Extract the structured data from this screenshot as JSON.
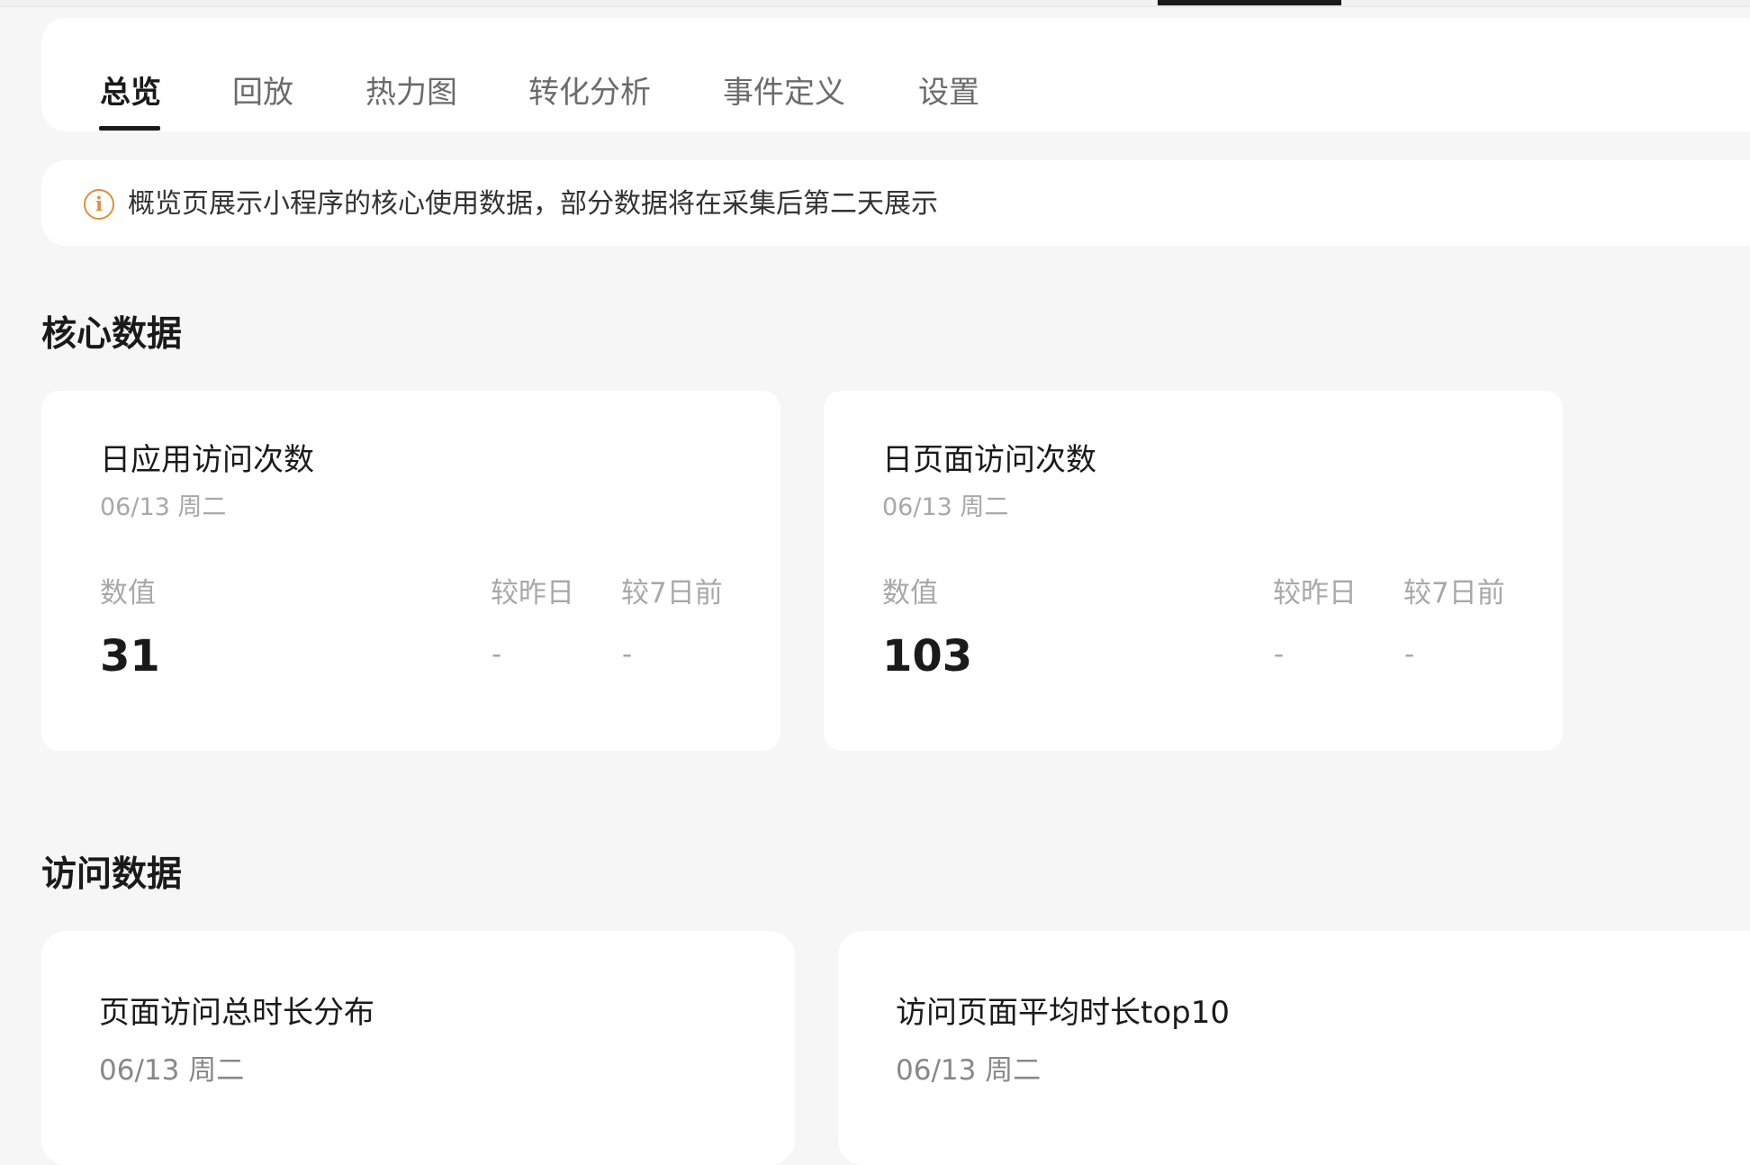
{
  "tabs": [
    {
      "label": "总览",
      "active": true
    },
    {
      "label": "回放",
      "active": false
    },
    {
      "label": "热力图",
      "active": false
    },
    {
      "label": "转化分析",
      "active": false
    },
    {
      "label": "事件定义",
      "active": false
    },
    {
      "label": "设置",
      "active": false
    }
  ],
  "notice": {
    "icon": "info-icon",
    "text": "概览页展示小程序的核心使用数据，部分数据将在采集后第二天展示",
    "icon_color": "#e08e3c"
  },
  "core_section": {
    "title": "核心数据",
    "cards": [
      {
        "title": "日应用访问次数",
        "date": "06/13 周二",
        "value_label": "数值",
        "value": "31",
        "compare_yesterday_label": "较昨日",
        "compare_yesterday": "-",
        "compare_7d_label": "较7日前",
        "compare_7d": "-"
      },
      {
        "title": "日页面访问次数",
        "date": "06/13 周二",
        "value_label": "数值",
        "value": "103",
        "compare_yesterday_label": "较昨日",
        "compare_yesterday": "-",
        "compare_7d_label": "较7日前",
        "compare_7d": "-"
      }
    ]
  },
  "visit_section": {
    "title": "访问数据",
    "cards": [
      {
        "title": "页面访问总时长分布",
        "date": "06/13 周二"
      },
      {
        "title": "访问页面平均时长top10",
        "date": "06/13 周二"
      }
    ]
  }
}
